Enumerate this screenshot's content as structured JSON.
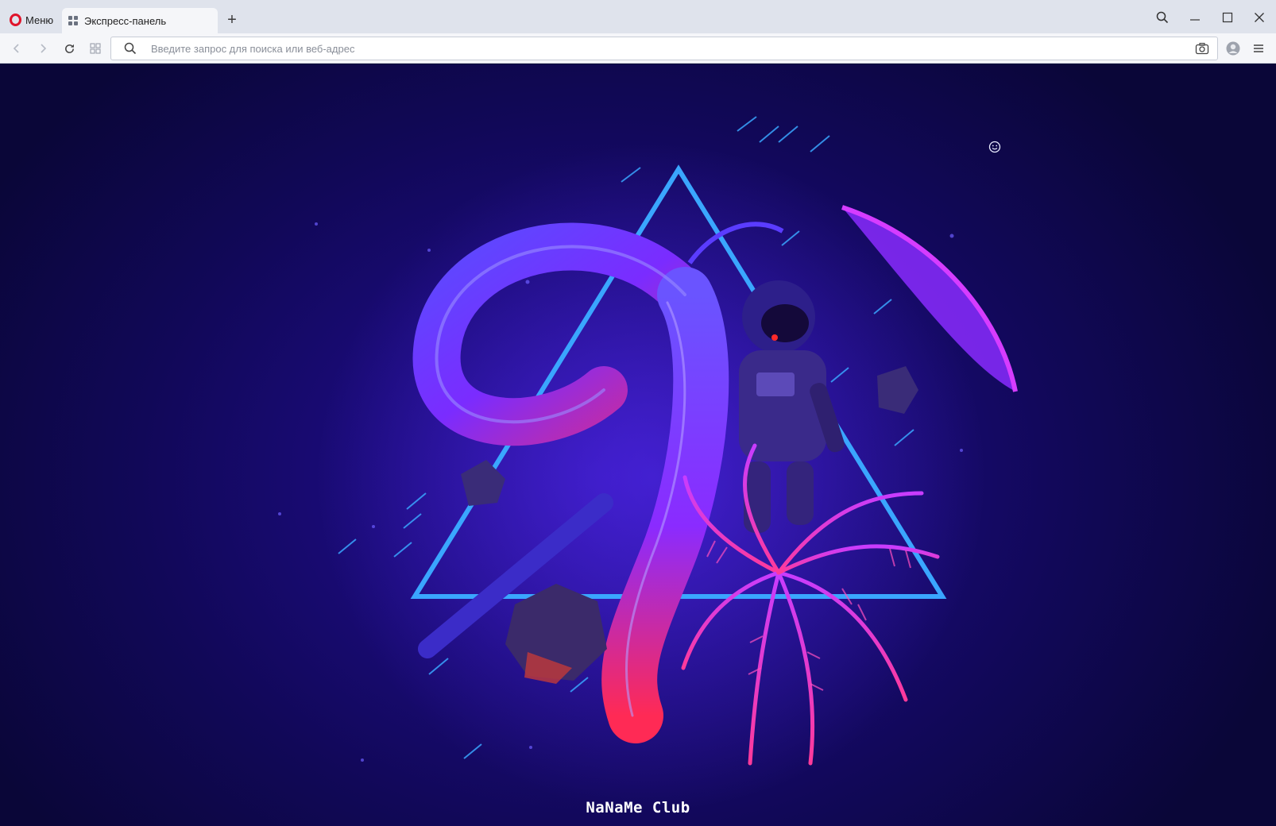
{
  "titlebar": {
    "menu_label": "Меню",
    "tab_title": "Экспресс-панель",
    "new_tab_symbol": "+"
  },
  "toolbar": {
    "address_placeholder": "Введите запрос для поиска или веб-адрес",
    "address_value": ""
  },
  "content": {
    "brand_text": "NaNaMe Club"
  },
  "colors": {
    "opera_red": "#e0142b",
    "titlebar_bg": "#dfe3ec",
    "toolbar_bg": "#f5f6f9",
    "wallpaper_deep": "#0a0638",
    "wallpaper_mid": "#2a12a0",
    "neon_cyan": "#3aa6ff",
    "neon_magenta": "#d63cff"
  },
  "icons": {
    "menu": "opera-logo-icon",
    "tab": "speed-dial-grid-icon",
    "back": "chevron-left-icon",
    "forward": "chevron-right-icon",
    "reload": "reload-icon",
    "tabs": "tab-grid-icon",
    "search": "search-icon",
    "snapshot": "camera-icon",
    "account": "user-icon",
    "easy_setup": "menu-lines-icon",
    "emoji": "smiley-icon",
    "minimize": "minimize-icon",
    "maximize": "maximize-icon",
    "close": "close-icon"
  }
}
